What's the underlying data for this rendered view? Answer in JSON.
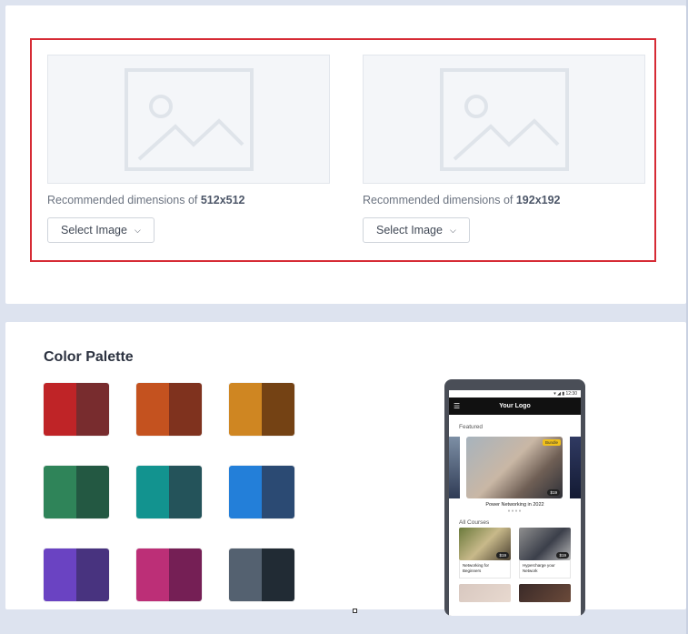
{
  "uploaders": [
    {
      "hint_prefix": "Recommended dimensions of ",
      "dimensions": "512x512",
      "button_label": "Select Image"
    },
    {
      "hint_prefix": "Recommended dimensions of ",
      "dimensions": "192x192",
      "button_label": "Select Image"
    }
  ],
  "palette": {
    "title": "Color Palette",
    "swatches": [
      {
        "primary": "#bf2427",
        "secondary": "#782c2e"
      },
      {
        "primary": "#c4521f",
        "secondary": "#7f321e"
      },
      {
        "primary": "#cf8622",
        "secondary": "#744214"
      },
      {
        "primary": "#2f8459",
        "secondary": "#235842"
      },
      {
        "primary": "#12938f",
        "secondary": "#24535a"
      },
      {
        "primary": "#237fd9",
        "secondary": "#2b4a73"
      },
      {
        "primary": "#6a43c2",
        "secondary": "#48337f"
      },
      {
        "primary": "#bc2f77",
        "secondary": "#751f55"
      },
      {
        "primary": "#546170",
        "secondary": "#212b34"
      }
    ]
  },
  "phone_preview": {
    "status_time": "12:30",
    "app_title": "Your Logo",
    "menu_icon": "☰",
    "featured_label": "Featured",
    "featured_badge": "Bundle",
    "featured_price": "$19",
    "featured_title": "Power Networking in 2022",
    "dots": "●●●●",
    "all_courses_label": "All Courses",
    "courses": [
      {
        "title": "Networking for Beginners",
        "price": "$19"
      },
      {
        "title": "Hypercharge your Network",
        "price": "$19"
      }
    ]
  },
  "icons": {
    "image_placeholder": "image-placeholder-icon",
    "chevron": "chevron-down-icon"
  }
}
